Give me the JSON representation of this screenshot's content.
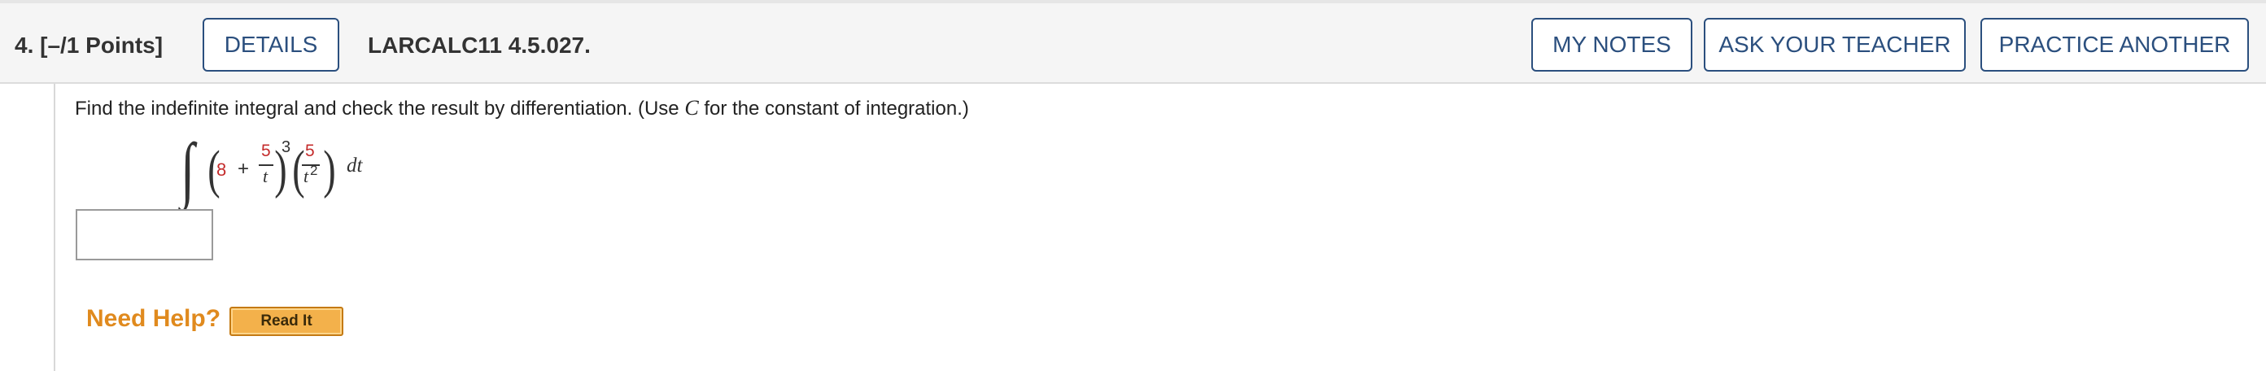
{
  "header": {
    "question_label": "4. [–/1 Points]",
    "details_button": "DETAILS",
    "problem_code": "LARCALC11 4.5.027.",
    "my_notes_button": "MY NOTES",
    "ask_teacher_button": "ASK YOUR TEACHER",
    "practice_another_button": "PRACTICE ANOTHER"
  },
  "problem": {
    "instruction_before": "Find the indefinite integral and check the result by differentiation. (Use ",
    "instruction_var": "C",
    "instruction_after": " for the constant of integration.)",
    "integral": {
      "constant": "8",
      "plus": "+",
      "frac1_num": "5",
      "frac1_den": "t",
      "exponent": "3",
      "frac2_num": "5",
      "frac2_den_base": "t",
      "frac2_den_exp": "2",
      "differential": "dt"
    },
    "answer_value": ""
  },
  "help": {
    "label": "Need Help?",
    "read_it_button": "Read It"
  },
  "colors": {
    "button_border": "#2b4f7e",
    "highlight_red": "#c42b2b",
    "help_orange": "#e08a1e",
    "read_it_fill": "#f3b14b"
  }
}
